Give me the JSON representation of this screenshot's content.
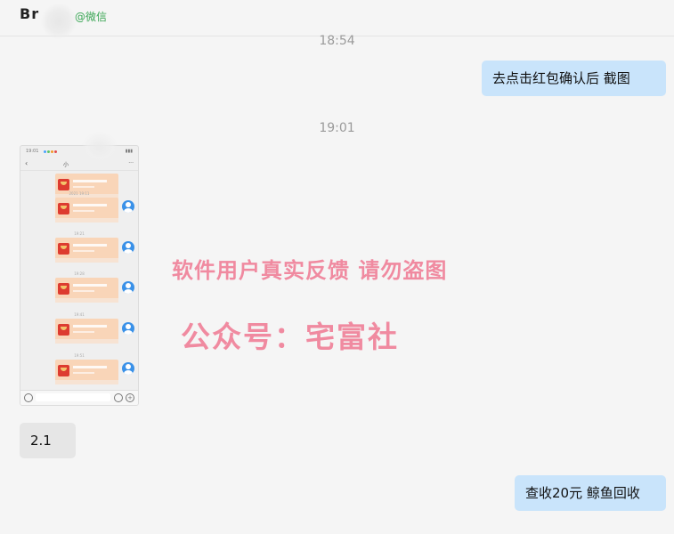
{
  "header": {
    "contact_name": "Br",
    "source_tag": "@微信"
  },
  "messages": {
    "timestamp_top": "18:54",
    "bubble1": "去点击红包确认后  截图",
    "timestamp_mid": "19:01",
    "bubble_left": "2.1",
    "bubble_last": "查收20元   鲸鱼回收"
  },
  "watermark": {
    "line1": "软件用户真实反馈  请勿盗图",
    "line2": "公众号：宅富社"
  },
  "screenshot": {
    "status_time": "19:01",
    "title": "小",
    "timestamps": [
      "2021 19:11",
      "19:21",
      "19:28",
      "19:41",
      "19:51"
    ]
  },
  "colors": {
    "background": "#f5f5f5",
    "bubble_self": "#c9e4fb",
    "bubble_other": "#e6e6e6",
    "watermark": "#f08aa0",
    "wechat_green": "#3aa655",
    "red_packet": "#f9d5b8"
  }
}
